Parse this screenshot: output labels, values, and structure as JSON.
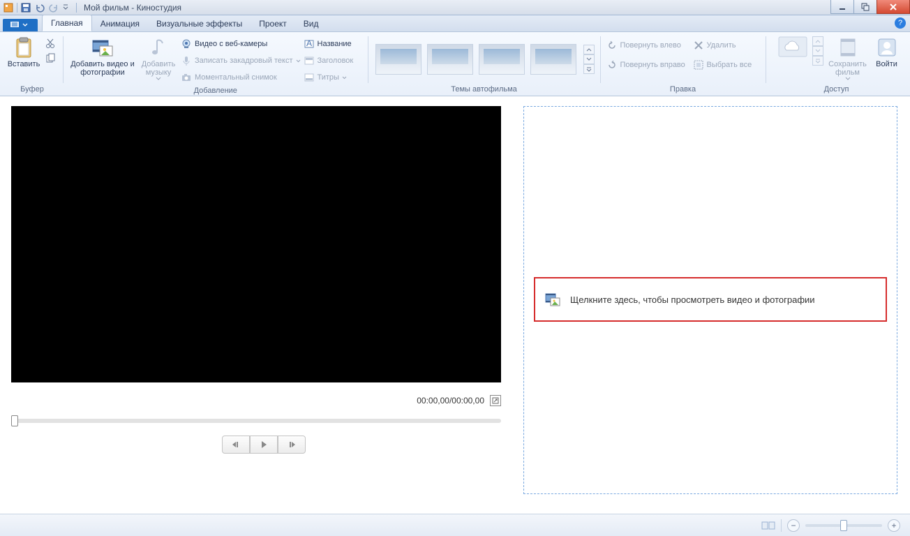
{
  "titlebar": {
    "title": "Мой фильм - Киностудия"
  },
  "tabs": {
    "file_label": "",
    "items": [
      "Главная",
      "Анимация",
      "Визуальные эффекты",
      "Проект",
      "Вид"
    ],
    "active_index": 0
  },
  "ribbon": {
    "buffer": {
      "paste": "Вставить",
      "group_label": "Буфер"
    },
    "add": {
      "add_video_photo": "Добавить видео и фотографии",
      "add_music": "Добавить музыку",
      "webcam": "Видео с веб-камеры",
      "narration": "Записать закадровый текст",
      "snapshot": "Моментальный снимок",
      "caption_title": "Название",
      "caption_header": "Заголовок",
      "caption_captions": "Титры",
      "group_label": "Добавление"
    },
    "themes": {
      "group_label": "Темы автофильма"
    },
    "edit": {
      "rotate_left": "Повернуть влево",
      "rotate_right": "Повернуть вправо",
      "delete": "Удалить",
      "select_all": "Выбрать все",
      "group_label": "Правка"
    },
    "access": {
      "save_movie": "Сохранить фильм",
      "sign_in": "Войти",
      "group_label": "Доступ"
    }
  },
  "preview": {
    "time": "00:00,00/00:00,00"
  },
  "timeline": {
    "placeholder": "Щелкните здесь, чтобы просмотреть видео и фотографии"
  }
}
